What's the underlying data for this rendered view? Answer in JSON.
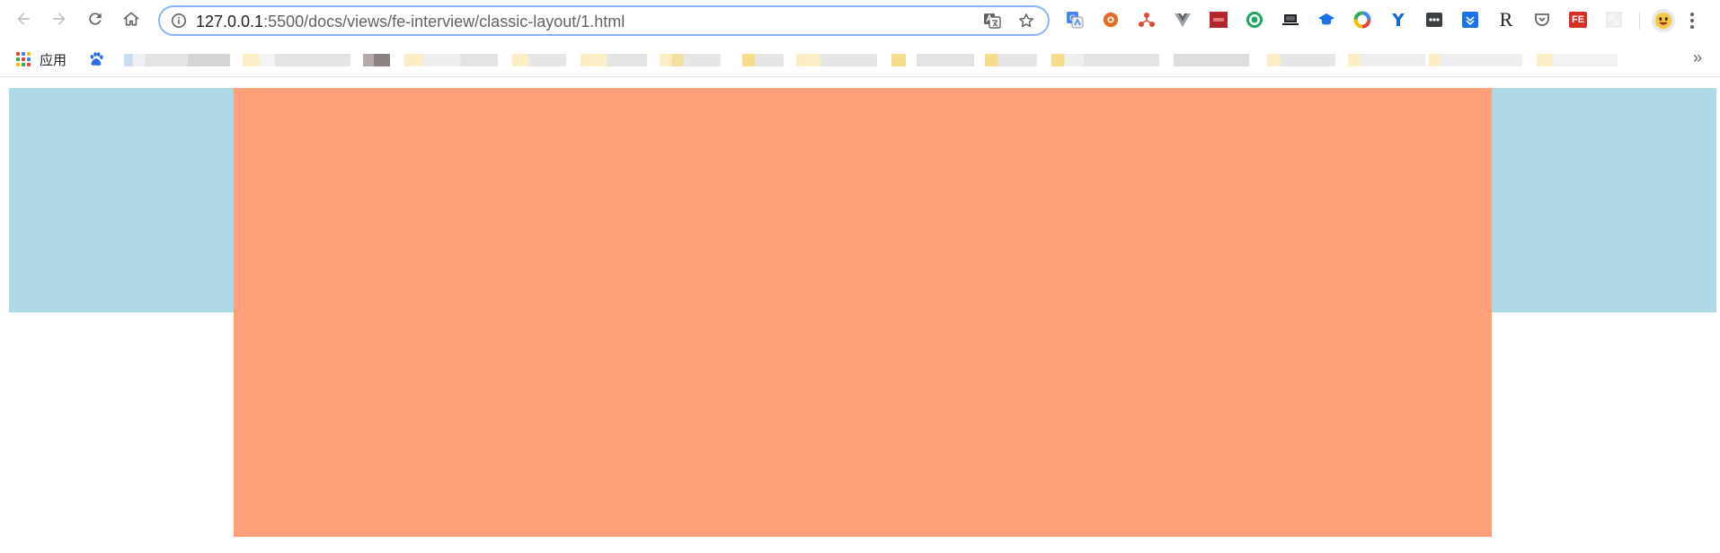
{
  "browser": {
    "url_host": "127.0.0.1",
    "url_path": ":5500/docs/views/fe-interview/classic-layout/1.html",
    "bookmarks": {
      "apps_label": "应用"
    },
    "extensions": [
      {
        "name": "google-translate-icon",
        "color": "#4285f4"
      },
      {
        "name": "orange-circle-icon",
        "color": "#ea6a21"
      },
      {
        "name": "network-icon",
        "color": "#e8453c"
      },
      {
        "name": "vue-devtools-icon",
        "color": "#9aa0a6"
      },
      {
        "name": "red-square-icon",
        "color": "#b3262b"
      },
      {
        "name": "green-circle-icon",
        "color": "#1fa463"
      },
      {
        "name": "laptop-icon",
        "color": "#202124"
      },
      {
        "name": "graduation-cap-icon",
        "color": "#1a73e8"
      },
      {
        "name": "rainbow-ring-icon",
        "color": "#ea4335"
      },
      {
        "name": "y-logo-icon",
        "color": "#1967d2"
      },
      {
        "name": "dots-box-icon",
        "color": "#3c4043"
      },
      {
        "name": "download-box-icon",
        "color": "#1a73e8"
      },
      {
        "name": "r-letter-icon",
        "color": "#202124"
      },
      {
        "name": "pocket-icon",
        "color": "#5f6368"
      },
      {
        "name": "fe-badge-icon",
        "color": "#d93025"
      },
      {
        "name": "blank-square-icon",
        "color": "#e8eaed"
      }
    ],
    "ext_r_letter": "R",
    "ext_fe_text": "FE",
    "chevron": "»"
  },
  "page": {
    "header_color": "#add8e6",
    "main_color": "#ffa07a"
  }
}
